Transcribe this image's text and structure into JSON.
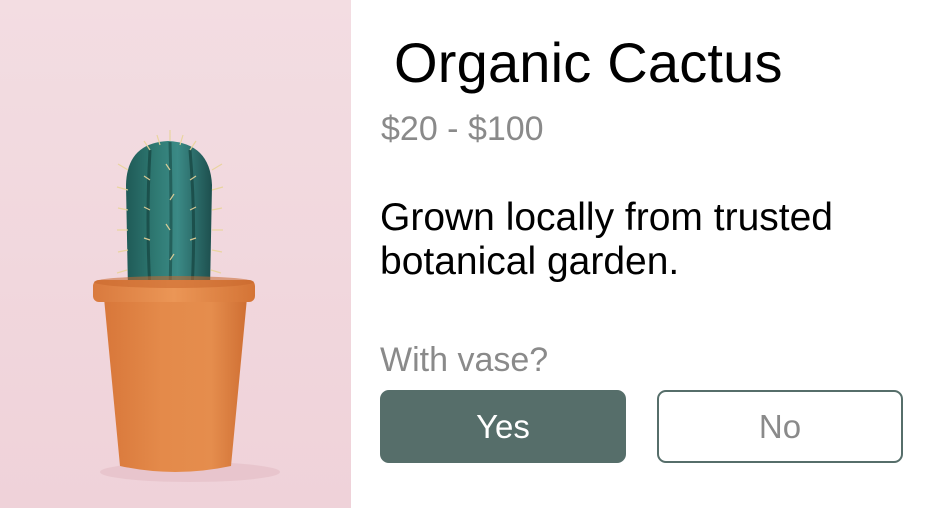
{
  "product": {
    "title": "Organic Cactus",
    "price": "$20 - $100",
    "description": "Grown locally from trusted botanical garden.",
    "image_subject": "cactus-in-terracotta-pot"
  },
  "option": {
    "label": "With vase?",
    "choices": [
      {
        "label": "Yes",
        "selected": true
      },
      {
        "label": "No",
        "selected": false
      }
    ]
  },
  "colors": {
    "accent": "#566e6a",
    "muted_text": "#8a8a8a",
    "image_background": "#f2dade",
    "pot": "#e0884a",
    "cactus": "#2f6f6a"
  }
}
